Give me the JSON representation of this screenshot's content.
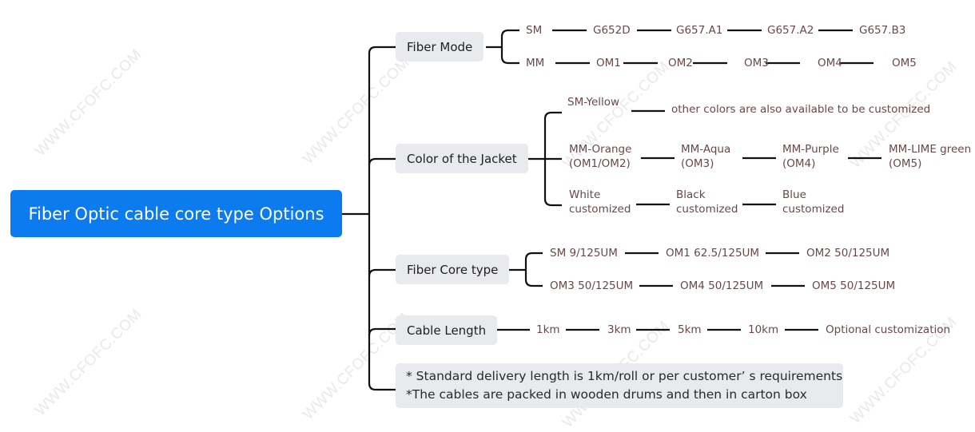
{
  "root": {
    "label": "Fiber Optic cable core type Options",
    "color": "#0b7bef"
  },
  "watermark": "WWW.CFOFC.COM",
  "branches": {
    "fiber_mode": {
      "label": "Fiber Mode",
      "rows": [
        [
          "SM",
          "G652D",
          "G657.A1",
          "G657.A2",
          "G657.B3"
        ],
        [
          "MM",
          "OM1",
          "OM2",
          "OM3",
          "OM4",
          "OM5"
        ]
      ]
    },
    "jacket_color": {
      "label": "Color of the Jacket",
      "rows": [
        [
          "SM-Yellow",
          "other colors are also available to be customized"
        ],
        [
          [
            "MM-Orange",
            "(OM1/OM2)"
          ],
          [
            "MM-Aqua",
            "(OM3)"
          ],
          [
            "MM-Purple",
            "(OM4)"
          ],
          [
            "MM-LIME green",
            "(OM5)"
          ]
        ],
        [
          [
            "White",
            "customized"
          ],
          [
            "Black",
            "customized"
          ],
          [
            "Blue",
            "customized"
          ]
        ]
      ]
    },
    "core_type": {
      "label": "Fiber Core type",
      "rows": [
        [
          "SM 9/125UM",
          "OM1 62.5/125UM",
          "OM2 50/125UM"
        ],
        [
          "OM3 50/125UM",
          "OM4 50/125UM",
          "OM5 50/125UM"
        ]
      ]
    },
    "cable_length": {
      "label": "Cable Length",
      "items": [
        "1km",
        "3km",
        "5km",
        "10km",
        "Optional customization"
      ]
    },
    "note": {
      "lines": [
        "* Standard delivery length is 1km/roll or per customer’ s requirements",
        "*The cables are packed in wooden drums and then in carton box"
      ]
    }
  },
  "colors": {
    "leaf_text": "#6b4848",
    "branch_bg": "#e8eaed",
    "line": "#111111"
  }
}
